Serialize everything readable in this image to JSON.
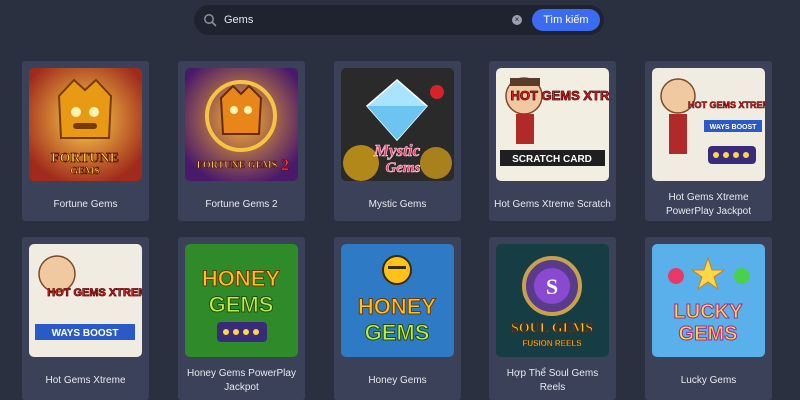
{
  "search": {
    "query": "Gems",
    "button_label": "Tìm kiếm",
    "clear_symbol": "×"
  },
  "games": [
    {
      "title": "Fortune Gems",
      "logo_line1": "FORTUNE",
      "logo_line2": "GEMS",
      "theme": "#a02a1c"
    },
    {
      "title": "Fortune Gems 2",
      "logo_line1": "FORTUNE GEMS",
      "logo_line2": "2",
      "theme": "#6a2a8a"
    },
    {
      "title": "Mystic Gems",
      "logo_line1": "Mystic",
      "logo_line2": "Gems",
      "theme": "#2a2a2a"
    },
    {
      "title": "Hot Gems Xtreme Scratch",
      "logo_line1": "HOT GEMS XTREME",
      "logo_line2": "SCRATCH CARD",
      "theme": "#f3eee2"
    },
    {
      "title": "Hot Gems Xtreme PowerPlay Jackpot",
      "logo_line1": "HOT GEMS XTREME",
      "logo_line2": "WAYS BOOST",
      "theme": "#f1ece2"
    },
    {
      "title": "Hot Gems Xtreme",
      "logo_line1": "HOT GEMS XTREME",
      "logo_line2": "WAYS BOOST",
      "theme": "#f1ece2"
    },
    {
      "title": "Honey Gems PowerPlay Jackpot",
      "logo_line1": "HONEY",
      "logo_line2": "GEMS",
      "theme": "#2f8a2a"
    },
    {
      "title": "Honey Gems",
      "logo_line1": "HONEY",
      "logo_line2": "GEMS",
      "theme": "#2e7ac4"
    },
    {
      "title": "Hợp Thể Soul Gems Reels",
      "logo_line1": "SOUL GEMS",
      "logo_line2": "FUSION REELS",
      "theme": "#173d44"
    },
    {
      "title": "Lucky Gems",
      "logo_line1": "LUCKY",
      "logo_line2": "GEMS",
      "theme": "#5ab0ea"
    }
  ]
}
